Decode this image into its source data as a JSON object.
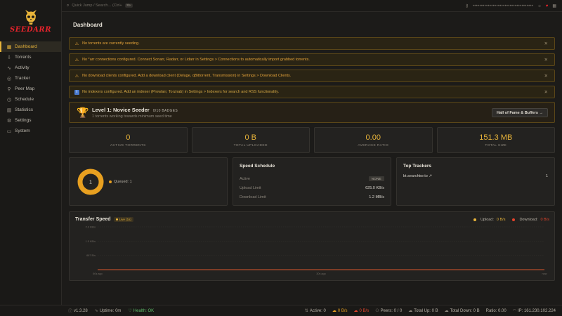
{
  "brand": {
    "name": "SEEDARR"
  },
  "search": {
    "placeholder": "Quick Jump / Search...",
    "shortcut": "(Ctrl+",
    "kbd": "⌘K"
  },
  "topbar": {
    "api_key": "••••••••••••••••••••••••••••••••••••"
  },
  "sidebar": {
    "items": [
      {
        "label": "Dashboard",
        "icon": "grid-icon"
      },
      {
        "label": "Torrents",
        "icon": "download-icon"
      },
      {
        "label": "Activity",
        "icon": "pulse-icon"
      },
      {
        "label": "Tracker",
        "icon": "globe-icon"
      },
      {
        "label": "Peer Map",
        "icon": "map-icon"
      },
      {
        "label": "Schedule",
        "icon": "clock-icon"
      },
      {
        "label": "Statistics",
        "icon": "stats-icon"
      },
      {
        "label": "Settings",
        "icon": "gear-icon"
      },
      {
        "label": "System",
        "icon": "monitor-icon"
      }
    ]
  },
  "page": {
    "title": "Dashboard"
  },
  "alerts": [
    {
      "text": "No torrents are currently seeding.",
      "type": "warning"
    },
    {
      "text": "No *arr connections configured. Connect Sonarr, Radarr, or Lidarr in Settings > Connections to automatically import grabbed torrents.",
      "type": "warning"
    },
    {
      "text": "No download clients configured. Add a download client (Deluge, qBittorrent, Transmission) in Settings > Download Clients.",
      "type": "warning"
    },
    {
      "text": "No indexers configured. Add an indexer (Prowlarr, Torznab) in Settings > Indexers for search and RSS functionality.",
      "type": "info"
    }
  ],
  "level": {
    "title": "Level 1: Novice Seeder",
    "badges": "0/10 BADGES",
    "subtitle": "1 torrents working towards minimum seed time",
    "button": "Hall of Fame & Buffers →"
  },
  "stats": [
    {
      "value": "0",
      "label": "ACTIVE TORRENTS"
    },
    {
      "value": "0 B",
      "label": "TOTAL UPLOADED"
    },
    {
      "value": "0.00",
      "label": "AVERAGE RATIO"
    },
    {
      "value": "151.3 MB",
      "label": "TOTAL SIZE"
    }
  ],
  "donut": {
    "center": "1",
    "legend": "Queued: 1",
    "color": "#e8a020"
  },
  "speed_schedule": {
    "title": "Speed Schedule",
    "active_label": "Active",
    "active_value": "NONE",
    "upload_label": "Upload Limit",
    "upload_value": "625.0 KB/s",
    "download_label": "Download Limit",
    "download_value": "1.2 MB/s"
  },
  "top_trackers": {
    "title": "Top Trackers",
    "items": [
      {
        "name": "bt.searchtor.to ↗",
        "count": "1"
      }
    ]
  },
  "transfer": {
    "title": "Transfer Speed",
    "live": "Live (1s)",
    "upload_label": "Upload:",
    "upload_value": "0 B/s",
    "download_label": "Download:",
    "download_value": "0 B/s"
  },
  "chart_data": {
    "type": "line",
    "title": "Transfer Speed",
    "x_ticks": [
      "60s ago",
      "30s ago",
      "now"
    ],
    "y_ticks": [
      "2.3 KB/s",
      "1.5 KB/s",
      "667 B/s",
      "0 B/s"
    ],
    "series": [
      {
        "name": "Upload",
        "color": "#e8b43a",
        "values": [
          0,
          0
        ]
      },
      {
        "name": "Download",
        "color": "#e3432b",
        "values": [
          0,
          0
        ]
      }
    ]
  },
  "statusbar": {
    "version": "v1.3.28",
    "uptime": "Uptime: 0m",
    "health": "Health: OK",
    "active": "Active: 0",
    "up_speed": "0 B/s",
    "down_speed": "0 B/s",
    "peers": "Peers: 0 / 0",
    "total_up": "Total Up: 0 B",
    "total_down": "Total Down: 0 B",
    "ratio": "Ratio: 0.00",
    "ip": "IP: 161.230.102.224"
  }
}
